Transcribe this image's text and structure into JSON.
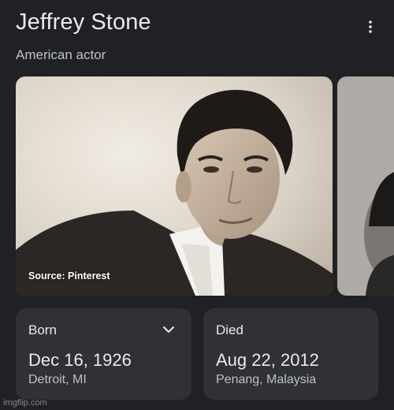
{
  "header": {
    "title": "Jeffrey Stone",
    "subtitle": "American actor",
    "menu_icon": "more-vert-icon"
  },
  "images": {
    "main_source": "Source: Pinterest"
  },
  "facts": [
    {
      "label": "Born",
      "date": "Dec 16, 1926",
      "place": "Detroit, MI",
      "expand_icon": "chevron-down-icon"
    },
    {
      "label": "Died",
      "date": "Aug 22, 2012",
      "place": "Penang, Malaysia"
    }
  ],
  "watermark": "imgflip.com",
  "colors": {
    "background": "#202124",
    "card": "#303134",
    "text_primary": "#e8eaed",
    "text_secondary": "#bdc1c6"
  }
}
